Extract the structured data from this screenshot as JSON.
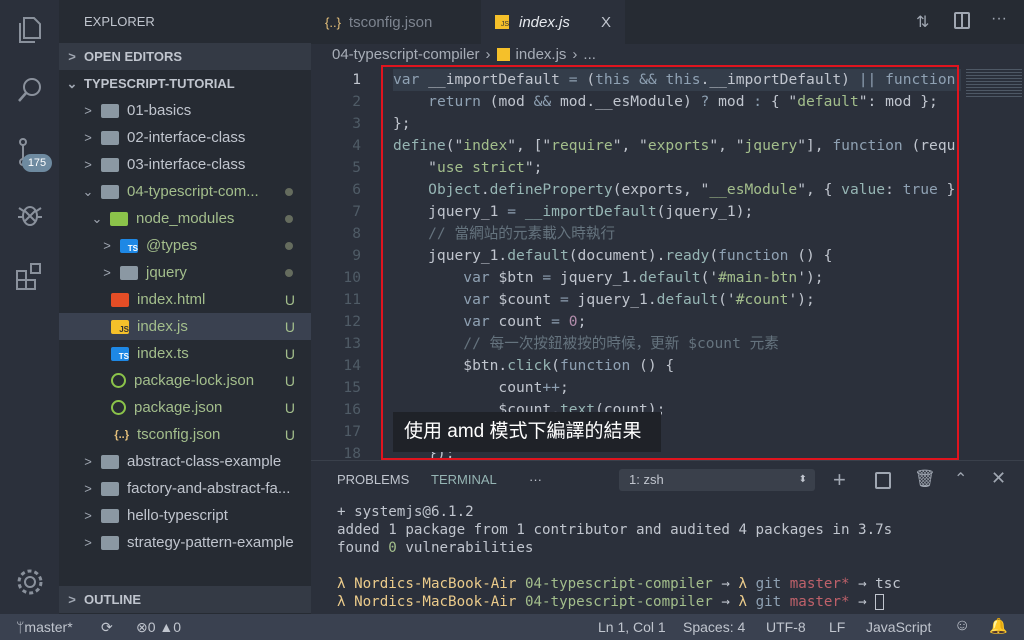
{
  "activity": [
    {
      "icon": "files-icon"
    },
    {
      "icon": "search-icon"
    },
    {
      "icon": "source-control-icon",
      "badge": "175"
    },
    {
      "icon": "debug-icon"
    },
    {
      "icon": "extensions-icon"
    },
    {
      "icon": "gear-icon"
    }
  ],
  "sidebar": {
    "title": "EXPLORER",
    "open_editors": "OPEN EDITORS",
    "root": "TYPESCRIPT-TUTORIAL",
    "outline": "OUTLINE",
    "items": [
      {
        "label": "01-basics",
        "type": "folder",
        "indent": 1,
        "chev": ">"
      },
      {
        "label": "02-interface-class",
        "type": "folder",
        "indent": 1,
        "chev": ">"
      },
      {
        "label": "03-interface-class",
        "type": "folder",
        "indent": 1,
        "chev": ">"
      },
      {
        "label": "04-typescript-com...",
        "type": "folder-open",
        "indent": 1,
        "chev": "v",
        "dot": true,
        "green": true
      },
      {
        "label": "node_modules",
        "type": "node",
        "indent": 2,
        "chev": "v",
        "dot": true,
        "green": true
      },
      {
        "label": "@types",
        "type": "ts-folder",
        "indent": 3,
        "chev": ">",
        "dot": true,
        "green": true
      },
      {
        "label": "jquery",
        "type": "folder",
        "indent": 3,
        "chev": ">",
        "dot": true,
        "green": true
      },
      {
        "label": "index.html",
        "type": "html",
        "indent": 3,
        "badge": "U",
        "green": true
      },
      {
        "label": "index.js",
        "type": "js",
        "indent": 3,
        "badge": "U",
        "green": true,
        "selected": true
      },
      {
        "label": "index.ts",
        "type": "ts",
        "indent": 3,
        "badge": "U",
        "green": true
      },
      {
        "label": "package-lock.json",
        "type": "node-json",
        "indent": 3,
        "badge": "U",
        "green": true
      },
      {
        "label": "package.json",
        "type": "node-json",
        "indent": 3,
        "badge": "U",
        "green": true
      },
      {
        "label": "tsconfig.json",
        "type": "json",
        "indent": 3,
        "badge": "U",
        "green": true
      },
      {
        "label": "abstract-class-example",
        "type": "folder",
        "indent": 1,
        "chev": ">"
      },
      {
        "label": "factory-and-abstract-fa...",
        "type": "folder",
        "indent": 1,
        "chev": ">"
      },
      {
        "label": "hello-typescript",
        "type": "folder",
        "indent": 1,
        "chev": ">"
      },
      {
        "label": "strategy-pattern-example",
        "type": "folder",
        "indent": 1,
        "chev": ">"
      }
    ]
  },
  "tabs": [
    {
      "label": "tsconfig.json",
      "icon": "json-icon"
    },
    {
      "label": "index.js",
      "icon": "js-icon",
      "active": true,
      "close": "X"
    }
  ],
  "breadcrumb": [
    "04-typescript-compiler",
    "index.js",
    "..."
  ],
  "editor": {
    "lines": [
      [
        [
          "var",
          "k"
        ],
        [
          " __importDefault ",
          "p"
        ],
        [
          "=",
          "k"
        ],
        [
          " (",
          "p"
        ],
        [
          "this",
          "k"
        ],
        [
          " ",
          "p"
        ],
        [
          "&&",
          "k"
        ],
        [
          " ",
          "p"
        ],
        [
          "this",
          "k"
        ],
        [
          ".__importDefault) ",
          "p"
        ],
        [
          "||",
          "k"
        ],
        [
          " ",
          "p"
        ],
        [
          "function",
          "k"
        ]
      ],
      [
        [
          "    ",
          "p"
        ],
        [
          "return",
          "k"
        ],
        [
          " (mod ",
          "p"
        ],
        [
          "&&",
          "k"
        ],
        [
          " mod.__esModule) ",
          "p"
        ],
        [
          "?",
          "k"
        ],
        [
          " mod ",
          "p"
        ],
        [
          ":",
          "k"
        ],
        [
          " { \"",
          "p"
        ],
        [
          "default",
          "s"
        ],
        [
          "\": mod };",
          "p"
        ]
      ],
      [
        [
          "};",
          "p"
        ]
      ],
      [
        [
          "define",
          "f"
        ],
        [
          "(\"",
          "p"
        ],
        [
          "index",
          "s"
        ],
        [
          "\", [\"",
          "p"
        ],
        [
          "require",
          "s"
        ],
        [
          "\", \"",
          "p"
        ],
        [
          "exports",
          "s"
        ],
        [
          "\", \"",
          "p"
        ],
        [
          "jquery",
          "s"
        ],
        [
          "\"], ",
          "p"
        ],
        [
          "function",
          "k"
        ],
        [
          " (requ",
          "p"
        ]
      ],
      [
        [
          "    \"",
          "p"
        ],
        [
          "use strict",
          "s"
        ],
        [
          "\";",
          "p"
        ]
      ],
      [
        [
          "    ",
          "p"
        ],
        [
          "Object",
          "f"
        ],
        [
          ".",
          "p"
        ],
        [
          "defineProperty",
          "f"
        ],
        [
          "(exports, \"",
          "p"
        ],
        [
          "__esModule",
          "s"
        ],
        [
          "\", { ",
          "p"
        ],
        [
          "value",
          "f"
        ],
        [
          ": ",
          "p"
        ],
        [
          "true",
          "k"
        ],
        [
          " }",
          "p"
        ]
      ],
      [
        [
          "    jquery_1 ",
          "p"
        ],
        [
          "=",
          "k"
        ],
        [
          " ",
          "p"
        ],
        [
          "__importDefault",
          "f"
        ],
        [
          "(jquery_1);",
          "p"
        ]
      ],
      [
        [
          "    // 當網站的元素載入時執行",
          "c"
        ]
      ],
      [
        [
          "    jquery_1.",
          "p"
        ],
        [
          "default",
          "f"
        ],
        [
          "(document).",
          "p"
        ],
        [
          "ready",
          "f"
        ],
        [
          "(",
          "p"
        ],
        [
          "function",
          "k"
        ],
        [
          " () {",
          "p"
        ]
      ],
      [
        [
          "        ",
          "p"
        ],
        [
          "var",
          "k"
        ],
        [
          " $btn ",
          "p"
        ],
        [
          "=",
          "k"
        ],
        [
          " jquery_1.",
          "p"
        ],
        [
          "default",
          "f"
        ],
        [
          "('",
          "p"
        ],
        [
          "#main-btn",
          "s"
        ],
        [
          "');",
          "p"
        ]
      ],
      [
        [
          "        ",
          "p"
        ],
        [
          "var",
          "k"
        ],
        [
          " $count ",
          "p"
        ],
        [
          "=",
          "k"
        ],
        [
          " jquery_1.",
          "p"
        ],
        [
          "default",
          "f"
        ],
        [
          "('",
          "p"
        ],
        [
          "#count",
          "s"
        ],
        [
          "');",
          "p"
        ]
      ],
      [
        [
          "        ",
          "p"
        ],
        [
          "var",
          "k"
        ],
        [
          " count ",
          "p"
        ],
        [
          "=",
          "k"
        ],
        [
          " ",
          "p"
        ],
        [
          "0",
          "n"
        ],
        [
          ";",
          "p"
        ]
      ],
      [
        [
          "        // 每一次按鈕被按的時候，更新 $count 元素",
          "c"
        ]
      ],
      [
        [
          "        $btn.",
          "p"
        ],
        [
          "click",
          "f"
        ],
        [
          "(",
          "p"
        ],
        [
          "function",
          "k"
        ],
        [
          " () {",
          "p"
        ]
      ],
      [
        [
          "            count",
          "p"
        ],
        [
          "++",
          "k"
        ],
        [
          ";",
          "p"
        ]
      ],
      [
        [
          "            $count.",
          "p"
        ],
        [
          "text",
          "f"
        ],
        [
          "(count);",
          "p"
        ]
      ],
      [
        [
          "        });",
          "p"
        ]
      ],
      [
        [
          "    });",
          "p"
        ]
      ]
    ],
    "cursor": "Ln 1, Col 1"
  },
  "caption": "使用 amd 模式下編譯的結果",
  "panel": {
    "tabs": [
      "PROBLEMS",
      "TERMINAL",
      "···"
    ],
    "terminal_select": "1: zsh",
    "lines": [
      [
        [
          "+ systemjs@6.1.2",
          "p"
        ]
      ],
      [
        [
          "added 1 package from 1 contributor and audited 4 packages in 3.7s",
          "p"
        ]
      ],
      [
        [
          "found ",
          "p"
        ],
        [
          "0",
          "s"
        ],
        [
          " vulnerabilities",
          "p"
        ]
      ],
      [
        [
          "",
          "p"
        ]
      ],
      [
        [
          "λ ",
          "y"
        ],
        [
          "Nordics-MacBook-Air ",
          "y"
        ],
        [
          "04-typescript-compiler",
          "s"
        ],
        [
          " → ",
          "p"
        ],
        [
          "λ ",
          "y"
        ],
        [
          "git ",
          "k"
        ],
        [
          "master*",
          "r"
        ],
        [
          " → ",
          "p"
        ],
        [
          "tsc",
          "p"
        ]
      ],
      [
        [
          "λ ",
          "y"
        ],
        [
          "Nordics-MacBook-Air ",
          "y"
        ],
        [
          "04-typescript-compiler",
          "s"
        ],
        [
          " → ",
          "p"
        ],
        [
          "λ ",
          "y"
        ],
        [
          "git ",
          "k"
        ],
        [
          "master*",
          "r"
        ],
        [
          " → ",
          "p"
        ]
      ]
    ]
  },
  "status": {
    "branch": "master*",
    "errors": "0",
    "warnings": "0",
    "position": "Ln 1, Col 1",
    "spaces": "Spaces: 4",
    "encoding": "UTF-8",
    "eol": "LF",
    "language": "JavaScript"
  }
}
